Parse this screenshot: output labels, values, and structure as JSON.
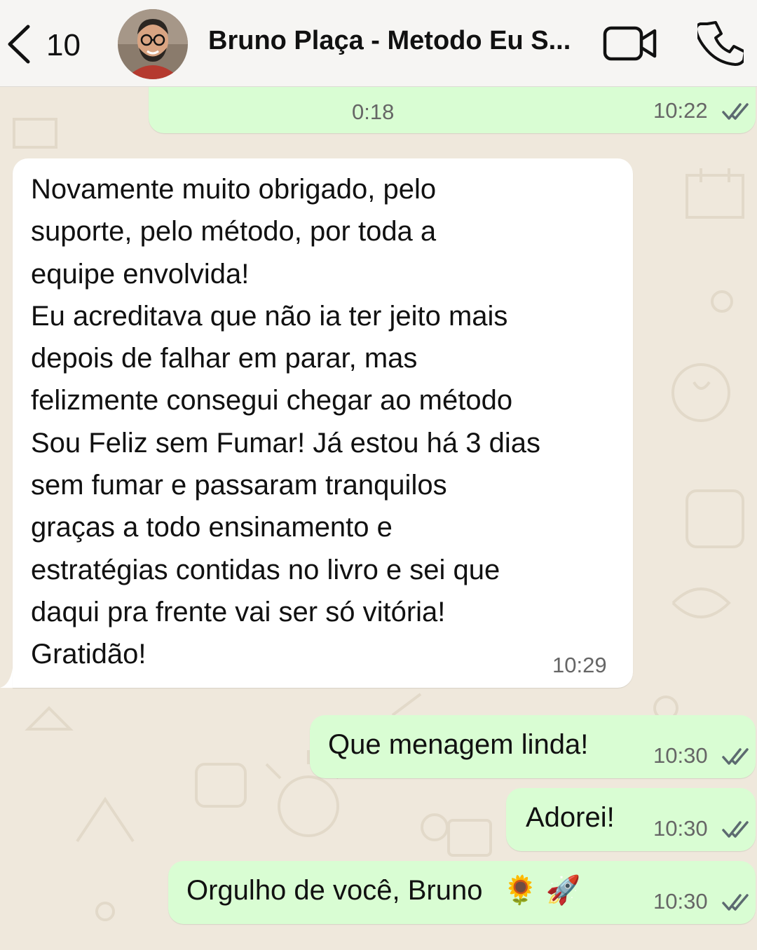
{
  "header": {
    "back_count": "10",
    "title": "Bruno Plaça - Metodo Eu S...",
    "avatar_icon": "contact-avatar",
    "video_icon": "video-camera-icon",
    "call_icon": "phone-icon"
  },
  "messages": [
    {
      "direction": "outgoing",
      "type": "audio",
      "duration": "0:18",
      "time": "10:22",
      "status": "read"
    },
    {
      "direction": "incoming",
      "type": "text",
      "lines": [
        "Novamente muito obrigado, pelo",
        "suporte, pelo método, por toda a",
        "equipe envolvida!",
        "Eu acreditava que não ia ter jeito mais",
        "depois de falhar em parar, mas",
        "felizmente consegui chegar ao método",
        "Sou Feliz sem Fumar! Já estou há 3 dias",
        "sem fumar e passaram tranquilos",
        "graças a todo ensinamento e",
        "estratégias contidas no livro e sei que",
        "daqui pra frente vai ser só vitória!",
        "Gratidão!"
      ],
      "time": "10:29"
    },
    {
      "direction": "outgoing",
      "type": "text",
      "text": "Que menagem linda!",
      "time": "10:30",
      "status": "read"
    },
    {
      "direction": "outgoing",
      "type": "text",
      "text": "Adorei!",
      "time": "10:30",
      "status": "read"
    },
    {
      "direction": "outgoing",
      "type": "text",
      "text": "Orgulho de você, Bruno",
      "emoji": "🌻 🚀",
      "time": "10:30",
      "status": "read"
    }
  ],
  "colors": {
    "outgoing_bubble": "#d9fdd3",
    "incoming_bubble": "#ffffff",
    "chat_background": "#efe8dc",
    "read_ticks": "#5c6a70"
  }
}
